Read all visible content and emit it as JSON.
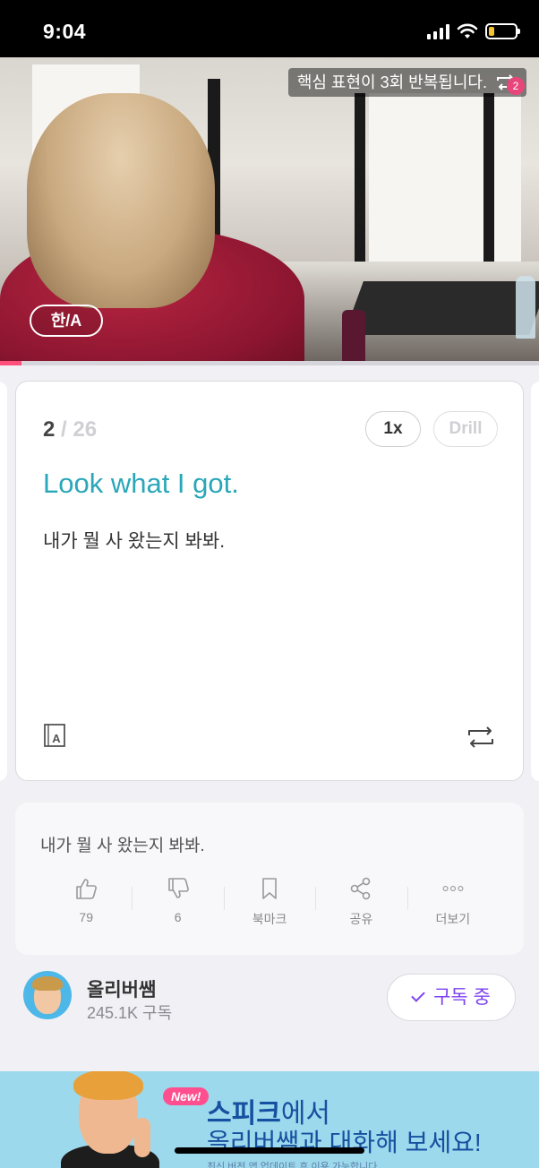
{
  "status_bar": {
    "time": "9:04",
    "battery_level": 0.2
  },
  "video": {
    "repeat_banner": "핵심 표현이 3회 반복됩니다.",
    "repeat_count": "2",
    "lang_toggle": "한/A",
    "progress": 0.04
  },
  "card": {
    "current": "2",
    "total": "/ 26",
    "speed_label": "1x",
    "drill_label": "Drill",
    "english": "Look what I got.",
    "korean": "내가 뭘 사 왔는지 봐봐."
  },
  "info": {
    "sentence": "내가 뭘 사 왔는지 봐봐.",
    "actions": [
      {
        "icon": "thumbs-up-icon",
        "label": "79"
      },
      {
        "icon": "thumbs-down-icon",
        "label": "6"
      },
      {
        "icon": "bookmark-icon",
        "label": "북마크"
      },
      {
        "icon": "share-icon",
        "label": "공유"
      },
      {
        "icon": "more-icon",
        "label": "더보기"
      }
    ]
  },
  "channel": {
    "name": "올리버쌤",
    "subscribers": "245.1K 구독",
    "subscribe_label": "구독 중"
  },
  "ad": {
    "badge": "New!",
    "brand": "스피크",
    "line1_rest": "에서",
    "line2": "올리버쌤과 대화해 보세요!",
    "line3": "최신 버전 앱 업데이트 후 이용 가능합니다"
  },
  "colors": {
    "accent": "#2aa7b8",
    "subscribe": "#7d42f0",
    "progress": "#ff4f7a",
    "ad_bg": "#9dd9ec"
  }
}
